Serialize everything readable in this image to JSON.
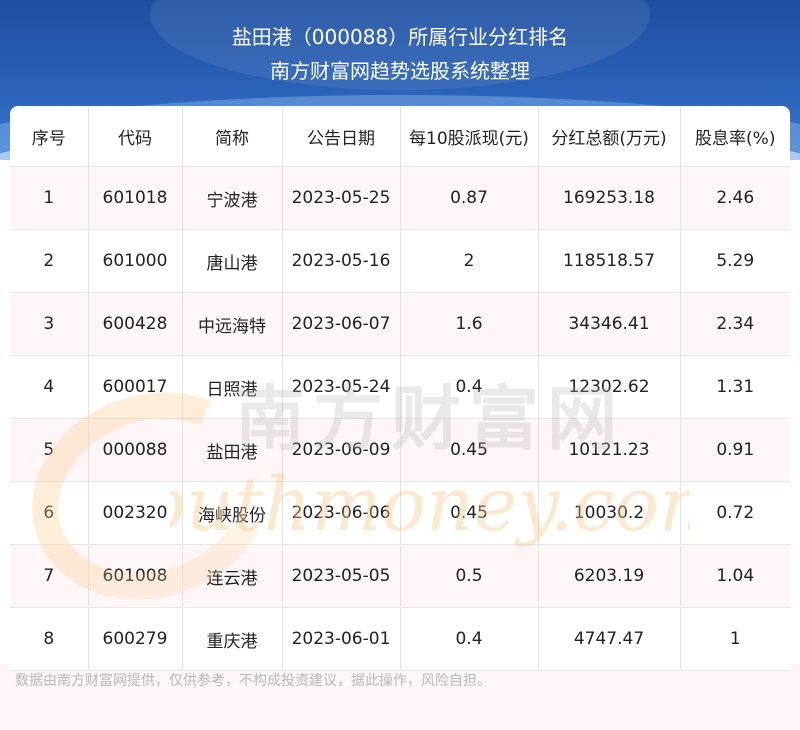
{
  "header": {
    "title_line1": "盐田港（000088）所属行业分红排名",
    "title_line2": "南方财富网趋势选股系统整理"
  },
  "table": {
    "columns": [
      "序号",
      "代码",
      "简称",
      "公告日期",
      "每10股派现(元)",
      "分红总额(万元)",
      "股息率(%)"
    ],
    "rows": [
      [
        "1",
        "601018",
        "宁波港",
        "2023-05-25",
        "0.87",
        "169253.18",
        "2.46"
      ],
      [
        "2",
        "601000",
        "唐山港",
        "2023-05-16",
        "2",
        "118518.57",
        "5.29"
      ],
      [
        "3",
        "600428",
        "中远海特",
        "2023-06-07",
        "1.6",
        "34346.41",
        "2.34"
      ],
      [
        "4",
        "600017",
        "日照港",
        "2023-05-24",
        "0.4",
        "12302.62",
        "1.31"
      ],
      [
        "5",
        "000088",
        "盐田港",
        "2023-06-09",
        "0.45",
        "10121.23",
        "0.91"
      ],
      [
        "6",
        "002320",
        "海峡股份",
        "2023-06-06",
        "0.45",
        "10030.2",
        "0.72"
      ],
      [
        "7",
        "601008",
        "连云港",
        "2023-05-05",
        "0.5",
        "6203.19",
        "1.04"
      ],
      [
        "8",
        "600279",
        "重庆港",
        "2023-06-01",
        "0.4",
        "4747.47",
        "1"
      ]
    ]
  },
  "watermark": {
    "cn": "南方财富网",
    "en": "Southmoney.com"
  },
  "footer": {
    "disclaimer": "数据由南方财富网提供，仅供参考，不构成投资建议，据此操作，风险自担。"
  },
  "colors": {
    "header_blue": "#2a62b8",
    "row_tint": "#fff6f8",
    "watermark_orange": "#f6c58d"
  }
}
